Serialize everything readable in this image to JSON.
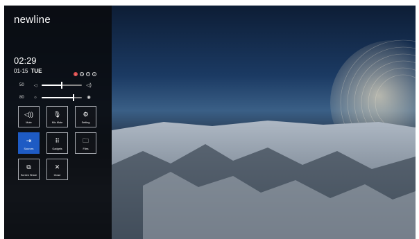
{
  "brand": "newline",
  "clock": {
    "time": "02:29",
    "date": "01-15",
    "weekday": "TUE"
  },
  "status_icons": [
    "alert-icon",
    "clock-icon",
    "wifi-icon",
    "help-icon"
  ],
  "volume": {
    "value": "50",
    "level": 0.5
  },
  "brightness": {
    "value": "80",
    "level": 0.8
  },
  "tiles": {
    "mute": "Mute",
    "mic_mute": "Mic Mute",
    "setting": "Setting",
    "sources": "Sources",
    "gadgets": "Gadgets",
    "files": "Files",
    "screen_share": "Screen Share",
    "close": "Close"
  },
  "colors": {
    "active_tile": "#1e5bc4",
    "panel": "#0a0c10"
  }
}
